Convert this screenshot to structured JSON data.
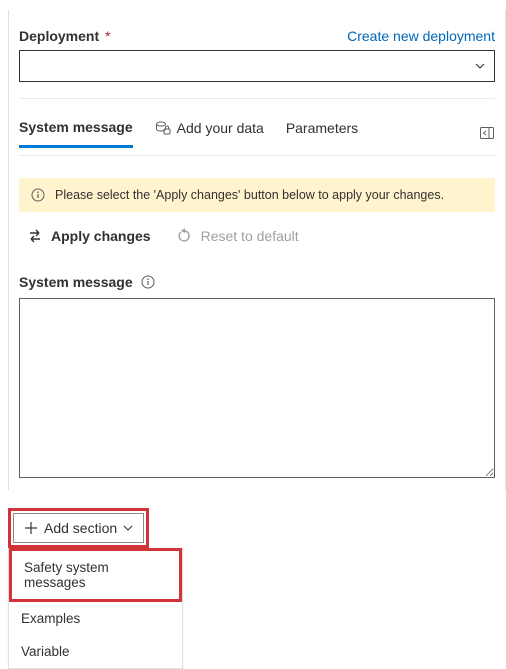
{
  "header": {
    "deployment_label": "Deployment",
    "required_marker": "*",
    "create_link": "Create new deployment",
    "selected_value": ""
  },
  "tabs": {
    "system_message": "System message",
    "add_your_data": "Add your data",
    "parameters": "Parameters"
  },
  "banner": {
    "text": "Please select the 'Apply changes' button below to apply your changes."
  },
  "actions": {
    "apply": "Apply changes",
    "reset": "Reset to default"
  },
  "system_message": {
    "label": "System message",
    "value": ""
  },
  "add_section": {
    "button": "Add section",
    "menu": {
      "safety": "Safety system messages",
      "examples": "Examples",
      "variable": "Variable"
    }
  }
}
